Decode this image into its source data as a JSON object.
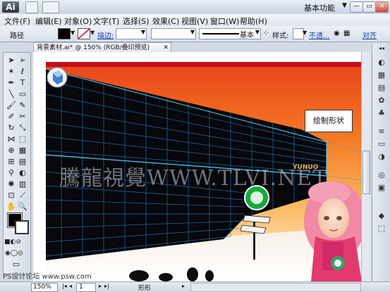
{
  "app": {
    "logo": "Ai",
    "workspace": "基本功能"
  },
  "menu": [
    "文件(F)",
    "编辑(E)",
    "对象(O)",
    "文字(T)",
    "选择(S)",
    "效果(C)",
    "视图(V)",
    "窗口(W)",
    "帮助(H)"
  ],
  "control": {
    "label": "路径",
    "stroke_link": "描边:",
    "style_preset": "基本",
    "style_label": "样式:",
    "opacity_link": "不透...",
    "align_link": "对齐"
  },
  "document": {
    "tab_title": "背景素材.ai* @ 150% (RGB/叠印预览)"
  },
  "status": {
    "zoom": "150%",
    "page": "1",
    "tool_label": "形形"
  },
  "canvas": {
    "callout": "绘制形状",
    "sign_text": "YUNUO",
    "watermark": "騰龍視覺WWW.TLVI.NET",
    "footer_watermark": "PS设计论坛 www.psw.com"
  },
  "colors": {
    "accent_red": "#c1101a",
    "wall": "#07070c",
    "grid": "#1f7fbf",
    "sky_top": "#e8441a",
    "sky_bottom": "#fff8e0"
  }
}
